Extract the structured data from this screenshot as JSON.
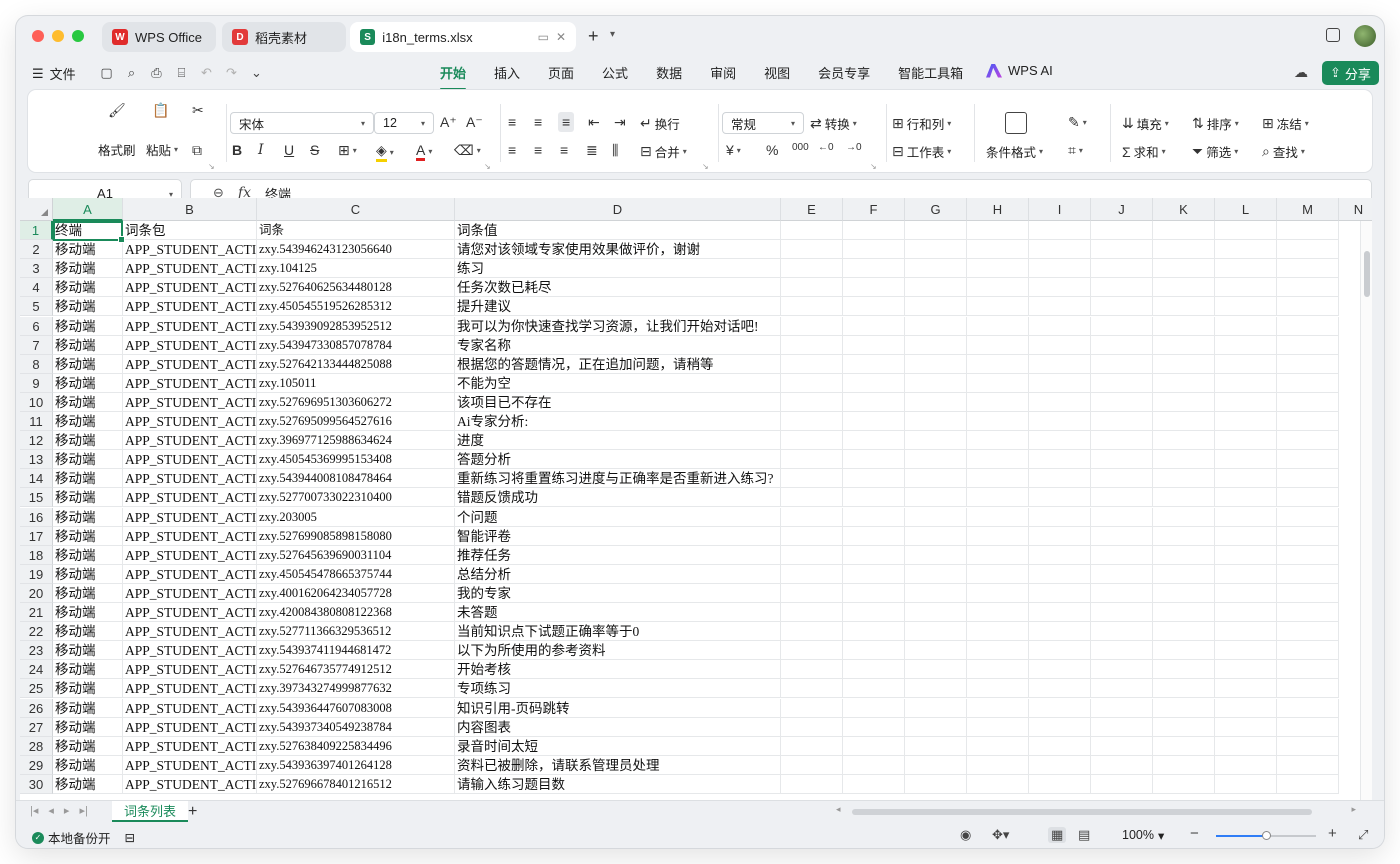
{
  "titlebar": {
    "tabs": [
      {
        "label": "WPS Office",
        "icon": "wps-logo-icon",
        "color": "#e02b2b"
      },
      {
        "label": "稻壳素材",
        "icon": "docer-logo-icon",
        "color": "#e23a3a"
      },
      {
        "label": "i18n_terms.xlsx",
        "icon": "sheet-logo-icon",
        "color": "#1a8a5a",
        "logo_text": "S"
      }
    ]
  },
  "menubar": {
    "file_label": "文件",
    "tabs": [
      "开始",
      "插入",
      "页面",
      "公式",
      "数据",
      "审阅",
      "视图",
      "会员专享",
      "智能工具箱"
    ],
    "active_tab": "开始",
    "ai_label": "WPS AI",
    "share_label": "分享"
  },
  "ribbon": {
    "format_painter": "格式刷",
    "paste": "粘贴",
    "font_name": "宋体",
    "font_size": "12",
    "wrap": "换行",
    "merge": "合并",
    "number_format": "常规",
    "convert": "转换",
    "row_col": "行和列",
    "worksheet": "工作表",
    "cond_format": "条件格式",
    "fill": "填充",
    "sort": "排序",
    "freeze": "冻结",
    "sum": "求和",
    "filter": "筛选",
    "find": "查找"
  },
  "formula_bar": {
    "cell_ref": "A1",
    "fx": "fx",
    "value": "终端"
  },
  "grid": {
    "columns": [
      "A",
      "B",
      "C",
      "D",
      "E",
      "F",
      "G",
      "H",
      "I",
      "J",
      "K",
      "L",
      "M",
      "N"
    ],
    "row_numbers": [
      "1",
      "2",
      "3",
      "4",
      "5",
      "6",
      "7",
      "8",
      "9",
      "10",
      "11",
      "12",
      "13",
      "14",
      "15",
      "16",
      "17",
      "18",
      "19",
      "20",
      "21",
      "22",
      "23",
      "24",
      "25",
      "26",
      "27",
      "28",
      "29",
      "30"
    ],
    "rows": [
      [
        "终端",
        "词条包",
        "词条",
        "词条值"
      ],
      [
        "移动端",
        "APP_STUDENT_ACTI",
        "zxy.543946243123056640",
        "请您对该领域专家使用效果做评价，谢谢"
      ],
      [
        "移动端",
        "APP_STUDENT_ACTI",
        "zxy.104125",
        "练习"
      ],
      [
        "移动端",
        "APP_STUDENT_ACTI",
        "zxy.527640625634480128",
        "任务次数已耗尽"
      ],
      [
        "移动端",
        "APP_STUDENT_ACTI",
        "zxy.450545519526285312",
        "提升建议"
      ],
      [
        "移动端",
        "APP_STUDENT_ACTI",
        "zxy.543939092853952512",
        "我可以为你快速查找学习资源，让我们开始对话吧!"
      ],
      [
        "移动端",
        "APP_STUDENT_ACTI",
        "zxy.543947330857078784",
        "专家名称"
      ],
      [
        "移动端",
        "APP_STUDENT_ACTI",
        "zxy.527642133444825088",
        "根据您的答题情况，正在追加问题，请稍等"
      ],
      [
        "移动端",
        "APP_STUDENT_ACTI",
        "zxy.105011",
        "不能为空"
      ],
      [
        "移动端",
        "APP_STUDENT_ACTI",
        "zxy.527696951303606272",
        "该项目已不存在"
      ],
      [
        "移动端",
        "APP_STUDENT_ACTI",
        "zxy.527695099564527616",
        "Ai专家分析:"
      ],
      [
        "移动端",
        "APP_STUDENT_ACTI",
        "zxy.396977125988634624",
        "进度"
      ],
      [
        "移动端",
        "APP_STUDENT_ACTI",
        "zxy.450545369995153408",
        "答题分析"
      ],
      [
        "移动端",
        "APP_STUDENT_ACTI",
        "zxy.543944008108478464",
        "重新练习将重置练习进度与正确率是否重新进入练习?"
      ],
      [
        "移动端",
        "APP_STUDENT_ACTI",
        "zxy.527700733022310400",
        "错题反馈成功"
      ],
      [
        "移动端",
        "APP_STUDENT_ACTI",
        "zxy.203005",
        "个问题"
      ],
      [
        "移动端",
        "APP_STUDENT_ACTI",
        "zxy.527699085898158080",
        "智能评卷"
      ],
      [
        "移动端",
        "APP_STUDENT_ACTI",
        "zxy.527645639690031104",
        "推荐任务"
      ],
      [
        "移动端",
        "APP_STUDENT_ACTI",
        "zxy.450545478665375744",
        "总结分析"
      ],
      [
        "移动端",
        "APP_STUDENT_ACTI",
        "zxy.400162064234057728",
        "我的专家"
      ],
      [
        "移动端",
        "APP_STUDENT_ACTI",
        "zxy.420084380808122368",
        "未答题"
      ],
      [
        "移动端",
        "APP_STUDENT_ACTI",
        "zxy.527711366329536512",
        "当前知识点下试题正确率等于0"
      ],
      [
        "移动端",
        "APP_STUDENT_ACTI",
        "zxy.543937411944681472",
        "以下为所使用的参考资料"
      ],
      [
        "移动端",
        "APP_STUDENT_ACTI",
        "zxy.527646735774912512",
        "开始考核"
      ],
      [
        "移动端",
        "APP_STUDENT_ACTI",
        "zxy.397343274999877632",
        "专项练习"
      ],
      [
        "移动端",
        "APP_STUDENT_ACTI",
        "zxy.543936447607083008",
        "知识引用-页码跳转"
      ],
      [
        "移动端",
        "APP_STUDENT_ACTI",
        "zxy.543937340549238784",
        "内容图表"
      ],
      [
        "移动端",
        "APP_STUDENT_ACTI",
        "zxy.527638409225834496",
        "录音时间太短"
      ],
      [
        "移动端",
        "APP_STUDENT_ACTI",
        "zxy.543936397401264128",
        "资料已被删除，请联系管理员处理"
      ],
      [
        "移动端",
        "APP_STUDENT_ACTI",
        "zxy.527696678401216512",
        "请输入练习题目数"
      ]
    ]
  },
  "sheetbar": {
    "sheet_name": "词条列表"
  },
  "statusbar": {
    "backup_label": "本地备份开",
    "zoom": "100%",
    "zoom_fraction": 0.5
  },
  "colors": {
    "accent": "#1a8a5a",
    "selection": "#2f7df6"
  }
}
